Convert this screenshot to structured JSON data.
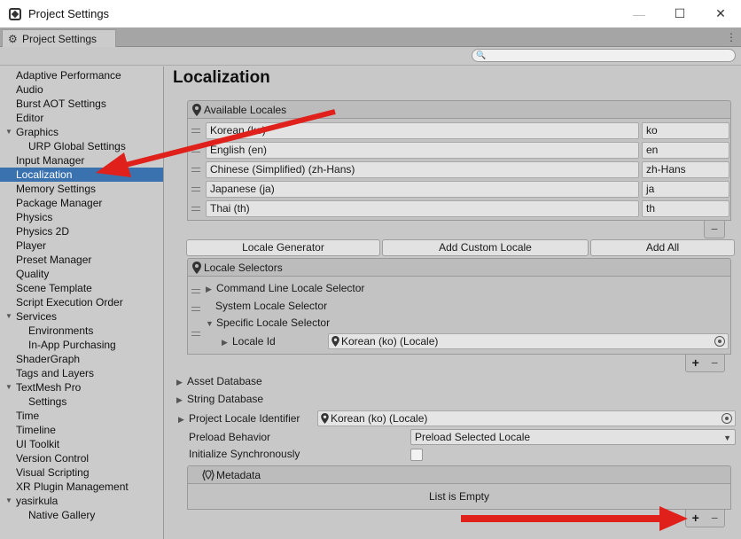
{
  "window": {
    "title": "Project Settings",
    "min": "—",
    "max": "☐",
    "close": "✕"
  },
  "tab": {
    "label": "Project Settings",
    "menu": "⋮"
  },
  "search": {
    "placeholder": ""
  },
  "sidebar": {
    "items": [
      {
        "label": "Adaptive Performance",
        "level": 1
      },
      {
        "label": "Audio",
        "level": 1
      },
      {
        "label": "Burst AOT Settings",
        "level": 1
      },
      {
        "label": "Editor",
        "level": 1
      },
      {
        "label": "Graphics",
        "level": 1,
        "expanded": true
      },
      {
        "label": "URP Global Settings",
        "level": 2
      },
      {
        "label": "Input Manager",
        "level": 1
      },
      {
        "label": "Localization",
        "level": 1,
        "selected": true
      },
      {
        "label": "Memory Settings",
        "level": 1
      },
      {
        "label": "Package Manager",
        "level": 1
      },
      {
        "label": "Physics",
        "level": 1
      },
      {
        "label": "Physics 2D",
        "level": 1
      },
      {
        "label": "Player",
        "level": 1
      },
      {
        "label": "Preset Manager",
        "level": 1
      },
      {
        "label": "Quality",
        "level": 1
      },
      {
        "label": "Scene Template",
        "level": 1
      },
      {
        "label": "Script Execution Order",
        "level": 1
      },
      {
        "label": "Services",
        "level": 1,
        "expanded": true
      },
      {
        "label": "Environments",
        "level": 2
      },
      {
        "label": "In-App Purchasing",
        "level": 2
      },
      {
        "label": "ShaderGraph",
        "level": 1
      },
      {
        "label": "Tags and Layers",
        "level": 1
      },
      {
        "label": "TextMesh Pro",
        "level": 1,
        "expanded": true
      },
      {
        "label": "Settings",
        "level": 2
      },
      {
        "label": "Time",
        "level": 1
      },
      {
        "label": "Timeline",
        "level": 1
      },
      {
        "label": "UI Toolkit",
        "level": 1
      },
      {
        "label": "Version Control",
        "level": 1
      },
      {
        "label": "Visual Scripting",
        "level": 1
      },
      {
        "label": "XR Plugin Management",
        "level": 1
      },
      {
        "label": "yasirkula",
        "level": 1,
        "expanded": true
      },
      {
        "label": "Native Gallery",
        "level": 2
      }
    ]
  },
  "main": {
    "title": "Localization",
    "available_locales": {
      "header": "Available Locales",
      "rows": [
        {
          "name": "Korean (ko)",
          "code": "ko"
        },
        {
          "name": "English (en)",
          "code": "en"
        },
        {
          "name": "Chinese (Simplified) (zh-Hans)",
          "code": "zh-Hans"
        },
        {
          "name": "Japanese (ja)",
          "code": "ja"
        },
        {
          "name": "Thai (th)",
          "code": "th"
        }
      ],
      "remove": "−"
    },
    "buttons": {
      "locale_generator": "Locale Generator",
      "add_custom_locale": "Add Custom Locale",
      "add_all": "Add All"
    },
    "locale_selectors": {
      "header": "Locale Selectors",
      "command_line": "Command Line Locale Selector",
      "system": "System Locale Selector",
      "specific": "Specific Locale Selector",
      "locale_id_label": "Locale Id",
      "locale_id_value": "Korean (ko) (Locale)",
      "add": "+",
      "remove": "−"
    },
    "asset_database": "Asset Database",
    "string_database": "String Database",
    "project_locale_identifier": {
      "label": "Project Locale Identifier",
      "value": "Korean (ko) (Locale)"
    },
    "preload_behavior": {
      "label": "Preload Behavior",
      "value": "Preload Selected Locale"
    },
    "initialize_synchronously": {
      "label": "Initialize Synchronously"
    },
    "metadata": {
      "header": "Metadata",
      "empty": "List is Empty",
      "add": "+",
      "remove": "−"
    }
  },
  "colors": {
    "selection": "#3a72b0",
    "arrow": "#e0201b"
  }
}
